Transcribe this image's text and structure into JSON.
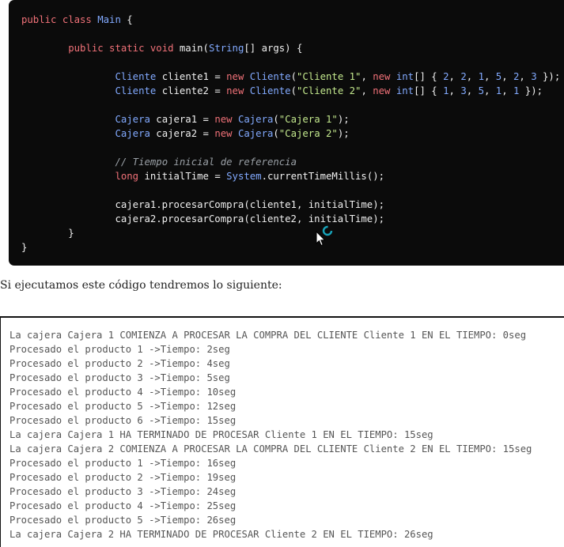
{
  "code_lines": [
    [
      {
        "t": "public class ",
        "c": "kw"
      },
      {
        "t": "Main",
        "c": "type"
      },
      {
        "t": " {",
        "c": "plain"
      }
    ],
    [],
    [
      {
        "t": "        ",
        "c": "plain"
      },
      {
        "t": "public static void ",
        "c": "kw"
      },
      {
        "t": "main(",
        "c": "plain"
      },
      {
        "t": "String",
        "c": "type"
      },
      {
        "t": "[] args) {",
        "c": "plain"
      }
    ],
    [],
    [
      {
        "t": "                ",
        "c": "plain"
      },
      {
        "t": "Cliente",
        "c": "type"
      },
      {
        "t": " cliente1 = ",
        "c": "plain"
      },
      {
        "t": "new ",
        "c": "kw"
      },
      {
        "t": "Cliente",
        "c": "type"
      },
      {
        "t": "(",
        "c": "plain"
      },
      {
        "t": "\"Cliente 1\"",
        "c": "str"
      },
      {
        "t": ", ",
        "c": "plain"
      },
      {
        "t": "new ",
        "c": "kw"
      },
      {
        "t": "int",
        "c": "type"
      },
      {
        "t": "[] { ",
        "c": "plain"
      },
      {
        "t": "2",
        "c": "num"
      },
      {
        "t": ", ",
        "c": "plain"
      },
      {
        "t": "2",
        "c": "num"
      },
      {
        "t": ", ",
        "c": "plain"
      },
      {
        "t": "1",
        "c": "num"
      },
      {
        "t": ", ",
        "c": "plain"
      },
      {
        "t": "5",
        "c": "num"
      },
      {
        "t": ", ",
        "c": "plain"
      },
      {
        "t": "2",
        "c": "num"
      },
      {
        "t": ", ",
        "c": "plain"
      },
      {
        "t": "3",
        "c": "num"
      },
      {
        "t": " });",
        "c": "plain"
      }
    ],
    [
      {
        "t": "                ",
        "c": "plain"
      },
      {
        "t": "Cliente",
        "c": "type"
      },
      {
        "t": " cliente2 = ",
        "c": "plain"
      },
      {
        "t": "new ",
        "c": "kw"
      },
      {
        "t": "Cliente",
        "c": "type"
      },
      {
        "t": "(",
        "c": "plain"
      },
      {
        "t": "\"Cliente 2\"",
        "c": "str"
      },
      {
        "t": ", ",
        "c": "plain"
      },
      {
        "t": "new ",
        "c": "kw"
      },
      {
        "t": "int",
        "c": "type"
      },
      {
        "t": "[] { ",
        "c": "plain"
      },
      {
        "t": "1",
        "c": "num"
      },
      {
        "t": ", ",
        "c": "plain"
      },
      {
        "t": "3",
        "c": "num"
      },
      {
        "t": ", ",
        "c": "plain"
      },
      {
        "t": "5",
        "c": "num"
      },
      {
        "t": ", ",
        "c": "plain"
      },
      {
        "t": "1",
        "c": "num"
      },
      {
        "t": ", ",
        "c": "plain"
      },
      {
        "t": "1",
        "c": "num"
      },
      {
        "t": " });",
        "c": "plain"
      }
    ],
    [],
    [
      {
        "t": "                ",
        "c": "plain"
      },
      {
        "t": "Cajera",
        "c": "type"
      },
      {
        "t": " cajera1 = ",
        "c": "plain"
      },
      {
        "t": "new ",
        "c": "kw"
      },
      {
        "t": "Cajera",
        "c": "type"
      },
      {
        "t": "(",
        "c": "plain"
      },
      {
        "t": "\"Cajera 1\"",
        "c": "str"
      },
      {
        "t": ");",
        "c": "plain"
      }
    ],
    [
      {
        "t": "                ",
        "c": "plain"
      },
      {
        "t": "Cajera",
        "c": "type"
      },
      {
        "t": " cajera2 = ",
        "c": "plain"
      },
      {
        "t": "new ",
        "c": "kw"
      },
      {
        "t": "Cajera",
        "c": "type"
      },
      {
        "t": "(",
        "c": "plain"
      },
      {
        "t": "\"Cajera 2\"",
        "c": "str"
      },
      {
        "t": ");",
        "c": "plain"
      }
    ],
    [],
    [
      {
        "t": "                ",
        "c": "plain"
      },
      {
        "t": "// Tiempo inicial de referencia",
        "c": "com"
      }
    ],
    [
      {
        "t": "                ",
        "c": "plain"
      },
      {
        "t": "long ",
        "c": "kw"
      },
      {
        "t": "initialTime = ",
        "c": "plain"
      },
      {
        "t": "System",
        "c": "type"
      },
      {
        "t": ".currentTimeMillis();",
        "c": "plain"
      }
    ],
    [],
    [
      {
        "t": "                cajera1.procesarCompra(cliente1, initialTime);",
        "c": "plain"
      }
    ],
    [
      {
        "t": "                cajera2.procesarCompra(cliente2, initialTime);",
        "c": "plain"
      }
    ],
    [
      {
        "t": "        }",
        "c": "plain"
      }
    ],
    [
      {
        "t": "}",
        "c": "plain"
      }
    ]
  ],
  "sentence": "Si ejecutamos este código tendremos lo siguiente:",
  "output_lines": [
    "La cajera Cajera 1 COMIENZA A PROCESAR LA COMPRA DEL CLIENTE Cliente 1 EN EL TIEMPO: 0seg",
    "Procesado el producto 1 ->Tiempo: 2seg",
    "Procesado el producto 2 ->Tiempo: 4seg",
    "Procesado el producto 3 ->Tiempo: 5seg",
    "Procesado el producto 4 ->Tiempo: 10seg",
    "Procesado el producto 5 ->Tiempo: 12seg",
    "Procesado el producto 6 ->Tiempo: 15seg",
    "La cajera Cajera 1 HA TERMINADO DE PROCESAR Cliente 1 EN EL TIEMPO: 15seg",
    "La cajera Cajera 2 COMIENZA A PROCESAR LA COMPRA DEL CLIENTE Cliente 2 EN EL TIEMPO: 15seg",
    "Procesado el producto 1 ->Tiempo: 16seg",
    "Procesado el producto 2 ->Tiempo: 19seg",
    "Procesado el producto 3 ->Tiempo: 24seg",
    "Procesado el producto 4 ->Tiempo: 25seg",
    "Procesado el producto 5 ->Tiempo: 26seg",
    "La cajera Cajera 2 HA TERMINADO DE PROCESAR Cliente 2 EN EL TIEMPO: 26seg"
  ],
  "icons": {
    "cursor": "mouse-pointer-icon",
    "loading": "loading-ring-icon"
  },
  "colors": {
    "code_background": "#0b0b0b",
    "keyword": "#f07178",
    "type": "#82aaff",
    "string": "#c3e88d",
    "comment": "#9aa0a6",
    "loading_ring": "#17a2b8"
  }
}
